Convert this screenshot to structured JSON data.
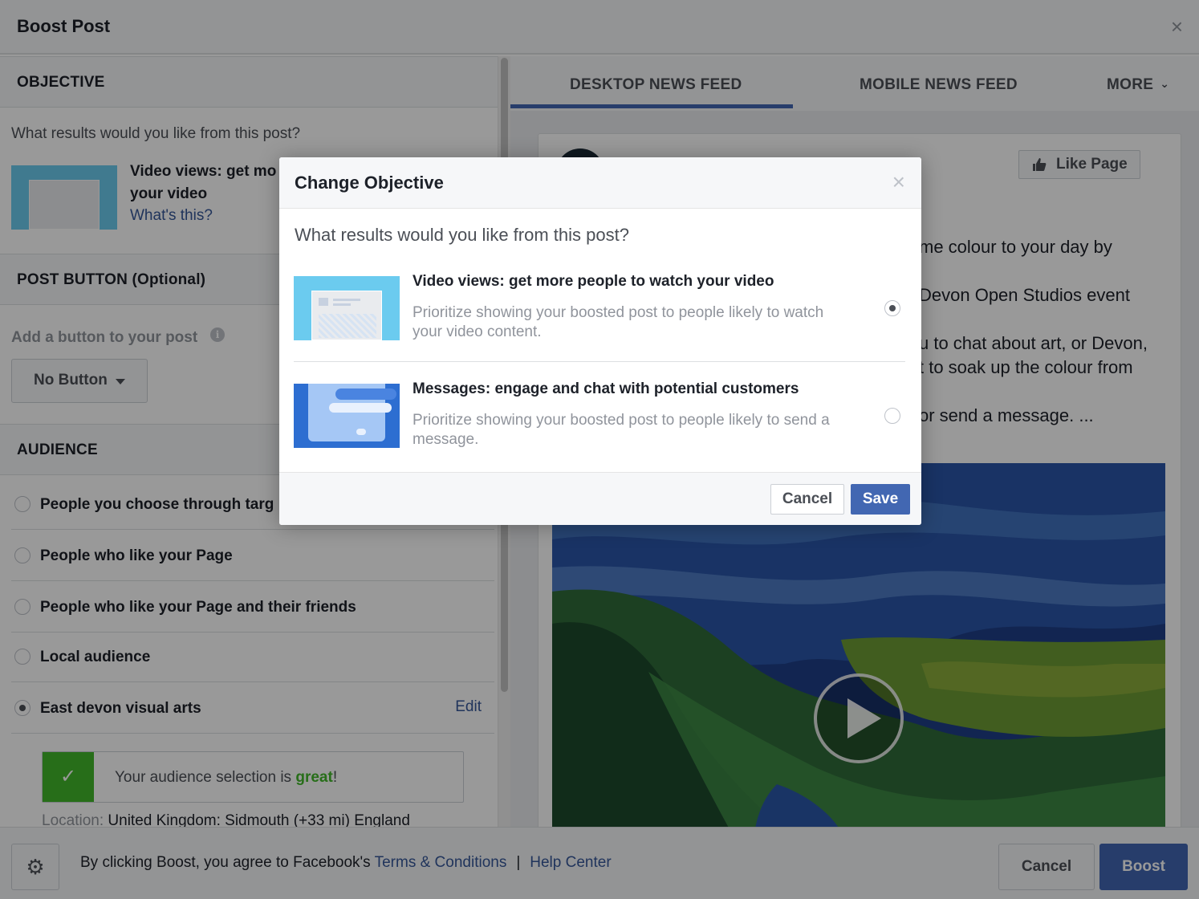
{
  "boost": {
    "title": "Boost Post",
    "close_glyph": "×"
  },
  "objective": {
    "heading": "OBJECTIVE",
    "question": "What results would you like from this post?",
    "selected_title": "Video views: get more people to watch your video",
    "selected_title_visible": "Video views: get mo your video",
    "whats_this": "What's this?"
  },
  "post_button": {
    "heading": "POST BUTTON (Optional)",
    "label": "Add a button to your post",
    "info_glyph": "i",
    "dropdown_value": "No Button"
  },
  "audience": {
    "heading": "AUDIENCE",
    "options": [
      {
        "label": "People you choose through targ",
        "selected": false
      },
      {
        "label": "People who like your Page",
        "selected": false
      },
      {
        "label": "People who like your Page and their friends",
        "selected": false
      },
      {
        "label": "Local audience",
        "selected": false
      },
      {
        "label": "East devon visual arts",
        "selected": true
      }
    ],
    "edit_label": "Edit",
    "feedback_prefix": "Your audience selection is ",
    "feedback_word": "great",
    "feedback_suffix": "!",
    "check_glyph": "✓",
    "location_key": "Location:",
    "location_value": "United Kingdom: Sidmouth (+33 mi) England"
  },
  "preview": {
    "tabs": [
      "DESKTOP NEWS FEED",
      "MOBILE NEWS FEED",
      "MORE"
    ],
    "active_tab": "DESKTOP NEWS FEED",
    "more_caret": "⌄",
    "like_page": "Like Page",
    "like_icon": "thumbs-up-icon",
    "post_lines": [
      "me colour to your day by",
      "Devon Open Studios event",
      "u to chat about art, or Devon,",
      "t to soak up the colour from",
      "or send a message. ..."
    ]
  },
  "footer": {
    "gear_glyph": "⚙",
    "agree_text": "By clicking Boost, you agree to Facebook's ",
    "terms_link": "Terms & Conditions",
    "separator": "|",
    "help_link": "Help Center",
    "cancel_label": "Cancel",
    "boost_label": "Boost"
  },
  "modal": {
    "title": "Change Objective",
    "close_glyph": "×",
    "question": "What results would you like from this post?",
    "options": [
      {
        "title": "Video views: get more people to watch your video",
        "description": "Prioritize showing your boosted post to people likely to watch your video content.",
        "selected": true
      },
      {
        "title": "Messages: engage and chat with potential customers",
        "description": "Prioritize showing your boosted post to people likely to send a message.",
        "selected": false
      }
    ],
    "cancel_label": "Cancel",
    "save_label": "Save"
  },
  "colors": {
    "brand_blue": "#4267b2",
    "link_blue": "#365899",
    "success_green": "#42b72a"
  }
}
